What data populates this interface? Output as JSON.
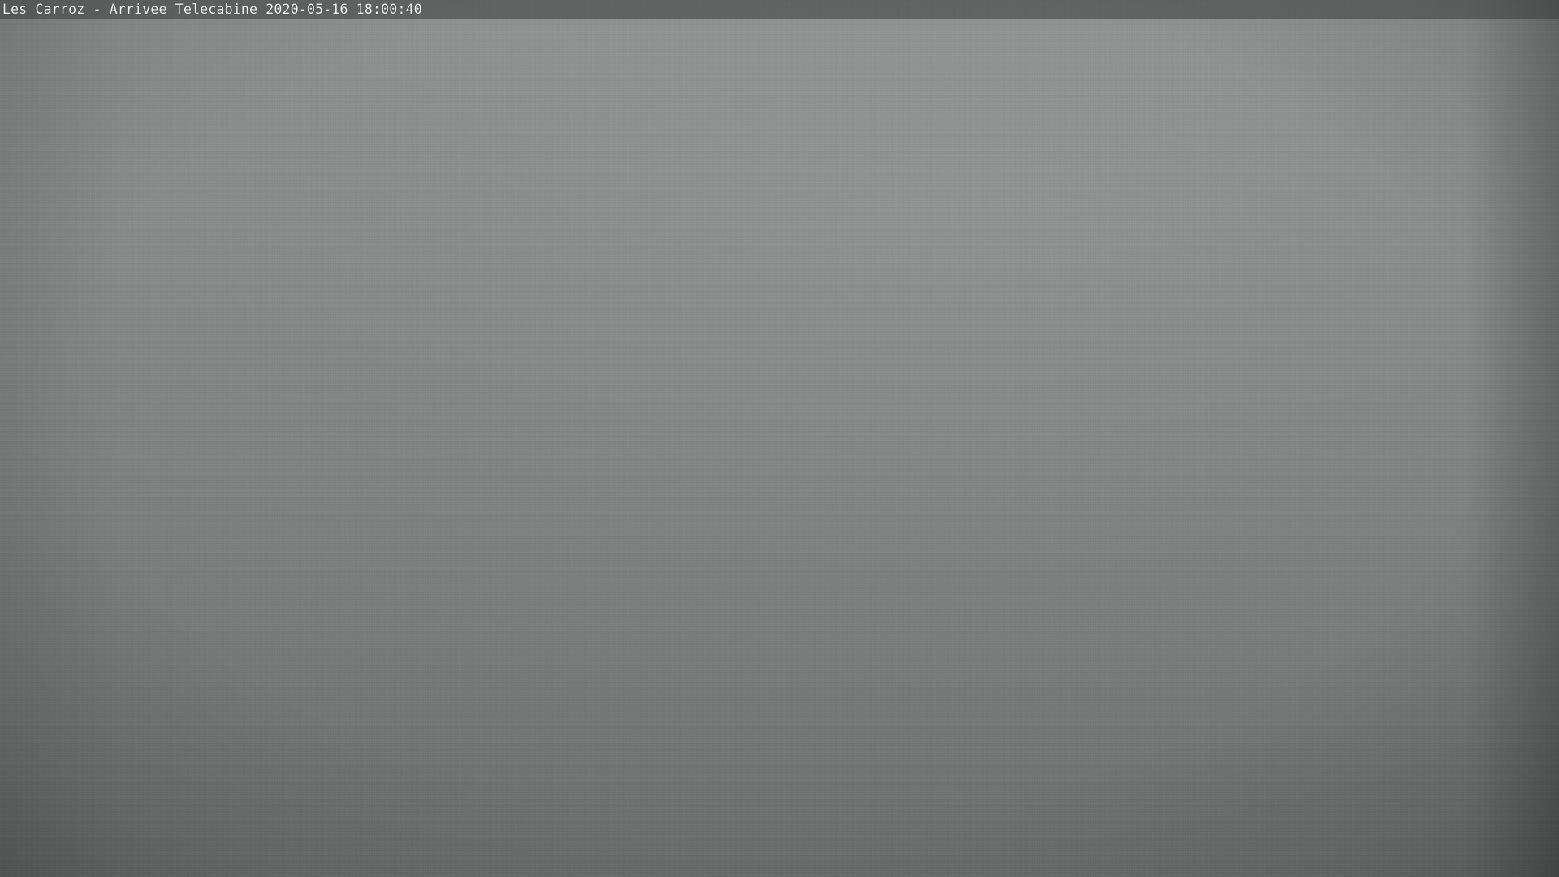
{
  "overlay": {
    "location": "Les Carroz - Arrivee Telecabine",
    "timestamp": "2020-05-16 18:00:40"
  },
  "colors": {
    "fog_top": "#8f9291",
    "fog_mid": "#7f8180",
    "fog_bottom": "#6c6e6d",
    "caption_text": "#f2f2f2"
  }
}
